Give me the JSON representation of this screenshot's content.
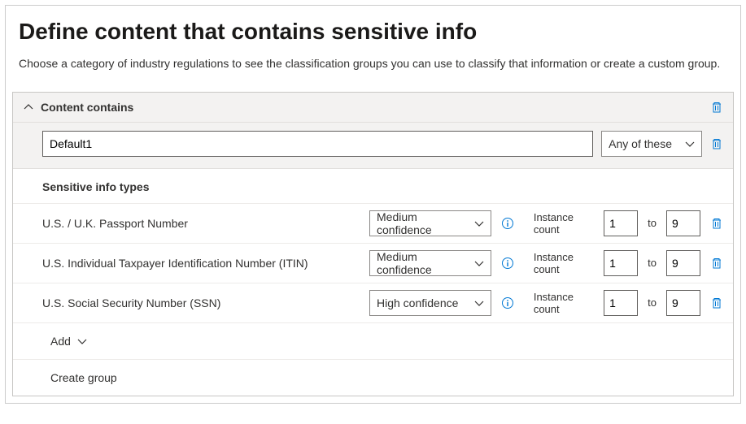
{
  "header": {
    "title": "Define content that contains sensitive info",
    "subtitle": "Choose a category of industry regulations to see the classification groups you can use to classify that information or create a custom group."
  },
  "panel": {
    "title": "Content contains",
    "group_name": "Default1",
    "match_mode": "Any of these",
    "section_title": "Sensitive info types",
    "instance_label": "Instance count",
    "to_label": "to",
    "items": [
      {
        "name": "U.S. / U.K. Passport Number",
        "confidence": "Medium confidence",
        "min": "1",
        "max": "9"
      },
      {
        "name": "U.S. Individual Taxpayer Identification Number (ITIN)",
        "confidence": "Medium confidence",
        "min": "1",
        "max": "9"
      },
      {
        "name": "U.S. Social Security Number (SSN)",
        "confidence": "High confidence",
        "min": "1",
        "max": "9"
      }
    ],
    "add_label": "Add",
    "create_group_label": "Create group"
  }
}
